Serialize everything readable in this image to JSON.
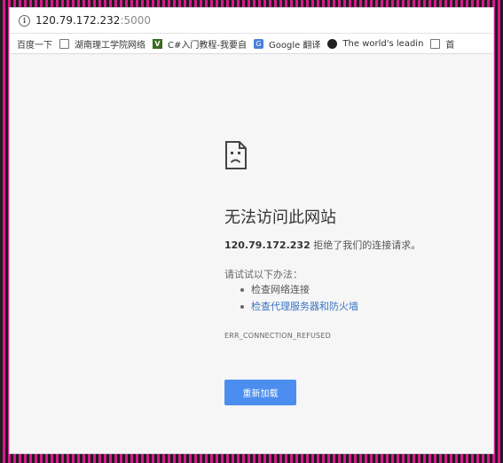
{
  "address_bar": {
    "host": "120.79.172.232",
    "port": ":5000"
  },
  "bookmarks": [
    {
      "label": "百度一下",
      "icon": "page-icon"
    },
    {
      "label": "湖南理工学院网络",
      "icon": "page-icon"
    },
    {
      "label": "C#入门教程-我要自",
      "icon": "v-icon"
    },
    {
      "label": "Google 翻译",
      "icon": "google-translate-icon"
    },
    {
      "label": "The world's leadin",
      "icon": "github-icon"
    },
    {
      "label": "首",
      "icon": "page-icon"
    }
  ],
  "error_page": {
    "title": "无法访问此网站",
    "host": "120.79.172.232",
    "description": " 拒绝了我们的连接请求。",
    "try_heading": "请试试以下办法：",
    "suggestions": [
      {
        "text": "检查网络连接",
        "is_link": false
      },
      {
        "text": "检查代理服务器和防火墙",
        "is_link": true
      }
    ],
    "error_code": "ERR_CONNECTION_REFUSED",
    "reload_label": "重新加载"
  },
  "colors": {
    "button": "#4b8ef0",
    "link": "#3b73c4",
    "page_bg": "#f6f6f6",
    "outer_border": "#d41a8c"
  }
}
